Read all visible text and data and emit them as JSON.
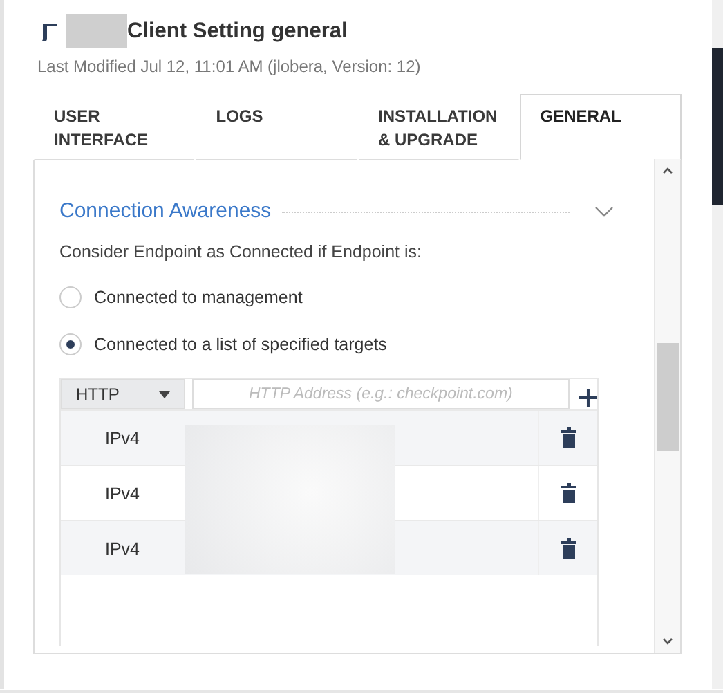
{
  "header": {
    "title": "Client Setting general",
    "subtitle": "Last Modified Jul 12, 11:01 AM (jlobera, Version: 12)"
  },
  "tabs": [
    {
      "label": "USER INTERFACE",
      "selected": false
    },
    {
      "label": "LOGS",
      "selected": false
    },
    {
      "label": "INSTALLATION & UPGRADE",
      "selected": false
    },
    {
      "label": "GENERAL",
      "selected": true
    }
  ],
  "section": {
    "title": "Connection Awareness",
    "expanded": true,
    "prompt": "Consider Endpoint as Connected if Endpoint is:",
    "options": [
      {
        "label": "Connected to management",
        "selected": false
      },
      {
        "label": "Connected to a list of specified targets",
        "selected": true
      }
    ]
  },
  "targets": {
    "type_select": "HTTP",
    "placeholder": "HTTP Address (e.g.: checkpoint.com)",
    "rows": [
      {
        "type": "IPv4"
      },
      {
        "type": "IPv4"
      },
      {
        "type": "IPv4"
      }
    ]
  }
}
